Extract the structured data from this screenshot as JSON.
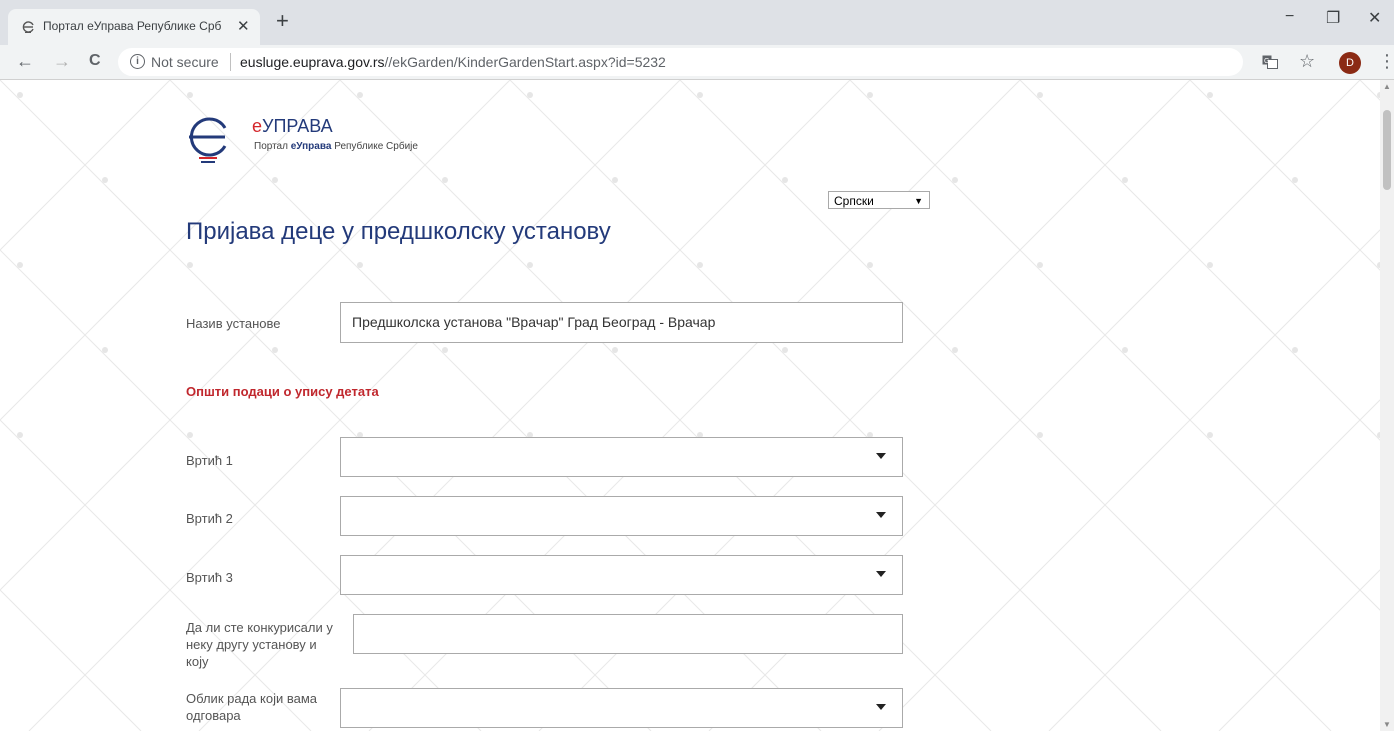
{
  "browser": {
    "tab_title": "Портал еУправа Републике Срб",
    "tab_close": "✕",
    "new_tab": "+",
    "window": {
      "minimize": "−",
      "restore": "❐",
      "close": "✕"
    },
    "nav": {
      "back": "←",
      "forward": "→",
      "reload": "C"
    },
    "security_label": "Not secure",
    "url_host": "eusluge.euprava.gov.rs",
    "url_path": "//ekGarden/KinderGardenStart.aspx?id=5232",
    "icons": [
      "translate-icon",
      "star-icon",
      "menu-icon"
    ],
    "star": "☆",
    "menu": "⋮",
    "profile_initial": "D"
  },
  "header": {
    "brand_prefix": "е",
    "brand_rest": "УПРАВА",
    "tagline_pre": "Портал ",
    "tagline_bold": "еУправа",
    "tagline_post": " Републике Србије",
    "language": "Српски"
  },
  "page_title": "Пријава деце у предшколску установу",
  "institution": {
    "label": "Назив установе",
    "value": "Предшколска установа \"Врачар\" Град Београд - Врачар"
  },
  "section_title": "Општи подаци о упису детата",
  "fields": {
    "kindergarten_1": {
      "label": "Вртић 1",
      "value": ""
    },
    "kindergarten_2": {
      "label": "Вртић 2",
      "value": ""
    },
    "kindergarten_3": {
      "label": "Вртић 3",
      "value": ""
    },
    "other_institution": {
      "label": "Да ли сте конкурисали у неку другу установу и коју",
      "value": ""
    },
    "work_form": {
      "label": "Облик рада који вама одговара",
      "value": ""
    }
  },
  "colors": {
    "brand_red": "#d4262b",
    "brand_blue": "#233a7a",
    "section_red": "#c0272d"
  }
}
